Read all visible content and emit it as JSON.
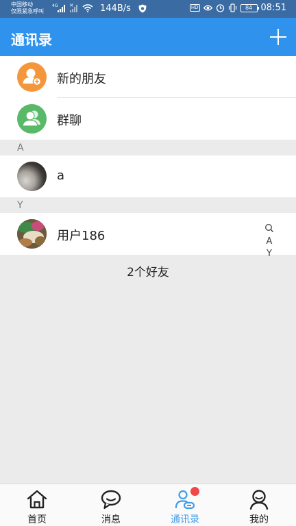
{
  "status_bar": {
    "carrier_line1": "中国移动",
    "carrier_line2": "仅限紧急呼叫",
    "network_tag": "4G",
    "no_signal_tag": "×",
    "net_speed": "144B/s",
    "hd_tag": "HD",
    "battery": "84",
    "time": "08:51"
  },
  "app_bar": {
    "title": "通讯录",
    "add_icon": "plus-icon"
  },
  "fixed_entries": [
    {
      "label": "新的朋友",
      "icon": "add-person-icon",
      "color": "#f4973c"
    },
    {
      "label": "群聊",
      "icon": "group-icon",
      "color": "#58b969"
    }
  ],
  "sections": [
    {
      "letter": "A",
      "contacts": [
        {
          "name": "a"
        }
      ]
    },
    {
      "letter": "Y",
      "contacts": [
        {
          "name": "用户186"
        }
      ]
    }
  ],
  "index_bar": {
    "search_icon": "search-icon",
    "letters": [
      "A",
      "Y"
    ]
  },
  "friend_count": "2个好友",
  "bottom_nav": [
    {
      "label": "首页",
      "icon": "home-icon",
      "active": false
    },
    {
      "label": "消息",
      "icon": "chat-bubble-icon",
      "active": false
    },
    {
      "label": "通讯录",
      "icon": "contacts-icon",
      "active": true,
      "badge": "red-dot"
    },
    {
      "label": "我的",
      "icon": "user-icon",
      "active": false
    }
  ],
  "colors": {
    "status_bar": "#3a6ca3",
    "app_bar": "#2f93ee",
    "active_tab": "#3f9cec",
    "background": "#ebebeb",
    "badge": "#f0474b"
  }
}
